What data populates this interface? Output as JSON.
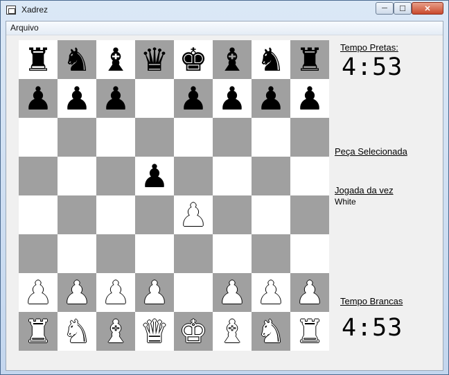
{
  "window": {
    "title": "Xadrez",
    "minimize": "─",
    "maximize": "☐",
    "close": "✕"
  },
  "menu": {
    "file": "Arquivo"
  },
  "board": [
    [
      [
        "b",
        "♜"
      ],
      [
        "b",
        "♞"
      ],
      [
        "b",
        "♝"
      ],
      [
        "b",
        "♛"
      ],
      [
        "b",
        "♚"
      ],
      [
        "b",
        "♝"
      ],
      [
        "b",
        "♞"
      ],
      [
        "b",
        "♜"
      ]
    ],
    [
      [
        "b",
        "♟"
      ],
      [
        "b",
        "♟"
      ],
      [
        "b",
        "♟"
      ],
      null,
      [
        "b",
        "♟"
      ],
      [
        "b",
        "♟"
      ],
      [
        "b",
        "♟"
      ],
      [
        "b",
        "♟"
      ]
    ],
    [
      null,
      null,
      null,
      null,
      null,
      null,
      null,
      null
    ],
    [
      null,
      null,
      null,
      [
        "b",
        "♟"
      ],
      null,
      null,
      null,
      null
    ],
    [
      null,
      null,
      null,
      null,
      [
        "w",
        "♟"
      ],
      null,
      null,
      null
    ],
    [
      null,
      null,
      null,
      null,
      null,
      null,
      null,
      null
    ],
    [
      [
        "w",
        "♟"
      ],
      [
        "w",
        "♟"
      ],
      [
        "w",
        "♟"
      ],
      [
        "w",
        "♟"
      ],
      null,
      [
        "w",
        "♟"
      ],
      [
        "w",
        "♟"
      ],
      [
        "w",
        "♟"
      ]
    ],
    [
      [
        "w",
        "♜"
      ],
      [
        "w",
        "♞"
      ],
      [
        "w",
        "♝"
      ],
      [
        "w",
        "♛"
      ],
      [
        "w",
        "♚"
      ],
      [
        "w",
        "♝"
      ],
      [
        "w",
        "♞"
      ],
      [
        "w",
        "♜"
      ]
    ]
  ],
  "side": {
    "black_time_label": "Tempo Pretas:",
    "black_time": "4:53",
    "selected_label": "Peça Selecionada",
    "turn_label": "Jogada da vez",
    "turn_value": "White",
    "white_time_label": "Tempo Brancas",
    "white_time": "4:53"
  }
}
